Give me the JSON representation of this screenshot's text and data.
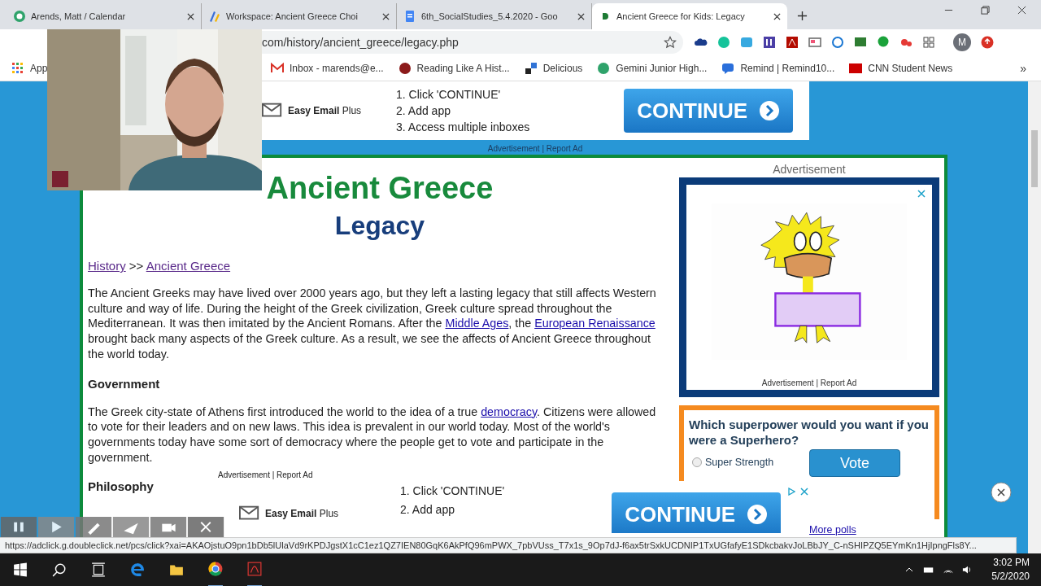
{
  "tabs": [
    {
      "title": "Arends, Matt / Calendar",
      "selected": false
    },
    {
      "title": "Workspace: Ancient Greece Choi",
      "selected": false
    },
    {
      "title": "6th_SocialStudies_5.4.2020 - Goo",
      "selected": false
    },
    {
      "title": "Ancient Greece for Kids: Legacy",
      "selected": true
    }
  ],
  "address": "com/history/ancient_greece/legacy.php",
  "profile_initial": "M",
  "bookmarks": [
    {
      "label": "App"
    },
    {
      "label": "Inbox - marends@e..."
    },
    {
      "label": "Reading Like A Hist..."
    },
    {
      "label": "Delicious"
    },
    {
      "label": "Gemini Junior High..."
    },
    {
      "label": "Remind | Remind10..."
    },
    {
      "label": "CNN Student News"
    }
  ],
  "bookmarks_more": "»",
  "top_ad": {
    "brand_bold": "Easy Email",
    "brand": "Plus",
    "steps": [
      "1. Click 'CONTINUE'",
      "2. Add app",
      "3. Access multiple inboxes"
    ],
    "button": "CONTINUE",
    "footer": "Advertisement | Report Ad"
  },
  "article": {
    "title": "Ancient Greece",
    "subtitle": "Legacy",
    "breadcrumb": [
      {
        "text": "History",
        "link": true
      },
      {
        "text": " >> ",
        "link": false
      },
      {
        "text": "Ancient Greece",
        "link": true
      }
    ],
    "intro": [
      {
        "text": "The Ancient Greeks may have lived over 2000 years ago, but they left a lasting legacy that still affects Western culture and way of life. During the height of the Greek civilization, Greek culture spread throughout the Mediterranean. It was then imitated by the Ancient Romans. After the ",
        "link": false
      },
      {
        "text": "Middle Ages",
        "link": true
      },
      {
        "text": ", the ",
        "link": false
      },
      {
        "text": "European Renaissance",
        "link": true
      },
      {
        "text": " brought back many aspects of the Greek culture. As a result, we see the affects of Ancient Greece throughout the world today.",
        "link": false
      }
    ],
    "sections": [
      {
        "heading": "Government",
        "parts": [
          {
            "text": "The Greek city-state of Athens first introduced the world to the idea of a true ",
            "link": false
          },
          {
            "text": "democracy",
            "link": true
          },
          {
            "text": ". Citizens were allowed to vote for their leaders and on new laws. This idea is prevalent in our world today. Most of the world's governments today have some sort of democracy where the people get to vote and participate in the government.",
            "link": false
          }
        ]
      },
      {
        "heading": "Philosophy"
      }
    ]
  },
  "side_ad": {
    "label": "Advertisement",
    "footer": "Advertisement | Report Ad"
  },
  "poll": {
    "question": "Which superpower would you want if you were a Superhero?",
    "options": [
      {
        "label": "Super Strength",
        "selected": false
      }
    ],
    "button": "Vote",
    "more": "More polls"
  },
  "bottom_ad": {
    "label": "Advertisement | Report Ad",
    "brand_bold": "Easy Email",
    "brand": "Plus",
    "steps": [
      "1. Click 'CONTINUE'",
      "2. Add app"
    ],
    "button": "CONTINUE"
  },
  "status_url": "https://adclick.g.doubleclick.net/pcs/click?xai=AKAOjstuO9pn1bDb5lUlaVd9rKPDJgstX1cC1ez1QZ7IEN80GqK6AkPfQ96mPWX_7pbVUss_T7x1s_9Op7dJ-f6ax5trSxkUCDNIP1TxUGfafyE1SDkcbakvJoLBbJY_C-nSHIPZQ5EYmKn1HjIpngFls8Y...",
  "clock": {
    "time": "3:02 PM",
    "date": "5/2/2020"
  }
}
